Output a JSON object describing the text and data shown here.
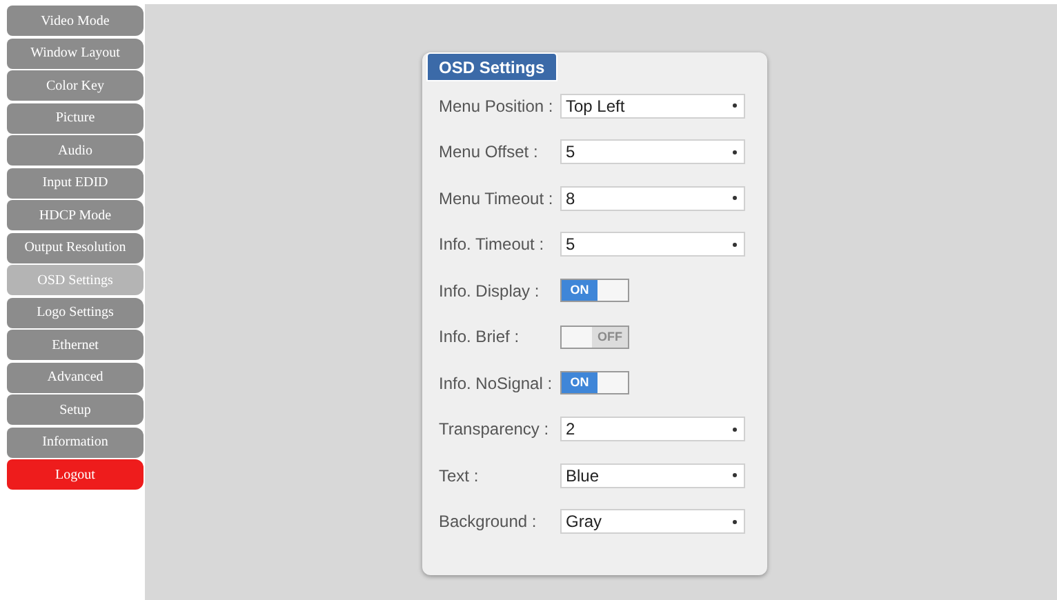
{
  "sidebar": {
    "items": [
      {
        "label": "Video Mode",
        "kind": "nav",
        "selected": false
      },
      {
        "label": "Window Layout",
        "kind": "nav",
        "selected": false
      },
      {
        "label": "Color Key",
        "kind": "nav",
        "selected": false
      },
      {
        "label": "Picture",
        "kind": "nav",
        "selected": false
      },
      {
        "label": "Audio",
        "kind": "nav",
        "selected": false
      },
      {
        "label": "Input EDID",
        "kind": "nav",
        "selected": false
      },
      {
        "label": "HDCP Mode",
        "kind": "nav",
        "selected": false
      },
      {
        "label": "Output Resolution",
        "kind": "nav",
        "selected": false
      },
      {
        "label": "OSD Settings",
        "kind": "nav",
        "selected": true
      },
      {
        "label": "Logo Settings",
        "kind": "nav",
        "selected": false
      },
      {
        "label": "Ethernet",
        "kind": "nav",
        "selected": false
      },
      {
        "label": "Advanced",
        "kind": "nav",
        "selected": false
      },
      {
        "label": "Setup",
        "kind": "nav",
        "selected": false
      },
      {
        "label": "Information",
        "kind": "nav",
        "selected": false
      },
      {
        "label": "Logout",
        "kind": "logout",
        "selected": false
      }
    ]
  },
  "panel": {
    "title": "OSD Settings",
    "rows": [
      {
        "label": "Menu Position :",
        "kind": "select",
        "value": "Top Left"
      },
      {
        "label": "Menu Offset :",
        "kind": "select",
        "value": "5"
      },
      {
        "label": "Menu Timeout :",
        "kind": "select",
        "value": "8"
      },
      {
        "label": "Info. Timeout :",
        "kind": "select",
        "value": "5"
      },
      {
        "label": "Info. Display :",
        "kind": "toggle",
        "on": true,
        "text": "ON"
      },
      {
        "label": "Info. Brief :",
        "kind": "toggle",
        "on": false,
        "text": "OFF"
      },
      {
        "label": "Info. NoSignal :",
        "kind": "toggle",
        "on": true,
        "text": "ON"
      },
      {
        "label": "Transparency :",
        "kind": "select",
        "value": "2"
      },
      {
        "label": "Text :",
        "kind": "select",
        "value": "Blue"
      },
      {
        "label": "Background :",
        "kind": "select",
        "value": "Gray"
      }
    ]
  }
}
